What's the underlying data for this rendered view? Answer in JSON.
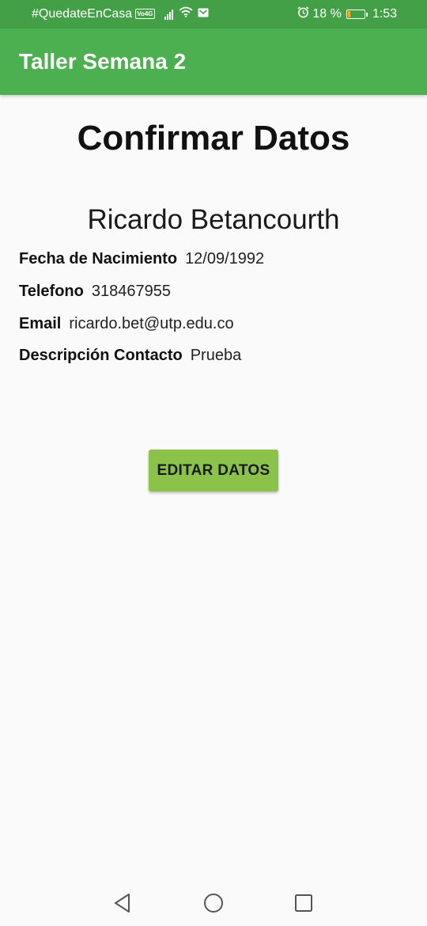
{
  "status_bar": {
    "carrier": "#QuedateEnCasa",
    "network_badge": "Vo4G",
    "battery_percent": "18 %",
    "battery_level": 0.18,
    "time": "1:53",
    "icons": [
      "signal-icon",
      "wifi-icon",
      "mail-icon",
      "alarm-icon",
      "battery-icon"
    ]
  },
  "app_bar": {
    "title": "Taller Semana 2",
    "color": "#4caf50"
  },
  "page": {
    "title": "Confirmar Datos",
    "name": "Ricardo Betancourth",
    "details": [
      {
        "label": "Fecha de Nacimiento",
        "value": "12/09/1992"
      },
      {
        "label": "Telefono",
        "value": "318467955"
      },
      {
        "label": "Email",
        "value": "ricardo.bet@utp.edu.co"
      },
      {
        "label": "Descripción Contacto",
        "value": "Prueba"
      }
    ],
    "edit_button_label": "EDITAR DATOS",
    "edit_button_color": "#8bc34a"
  },
  "nav_bar": {
    "icons": [
      "back-icon",
      "home-icon",
      "recents-icon"
    ]
  }
}
